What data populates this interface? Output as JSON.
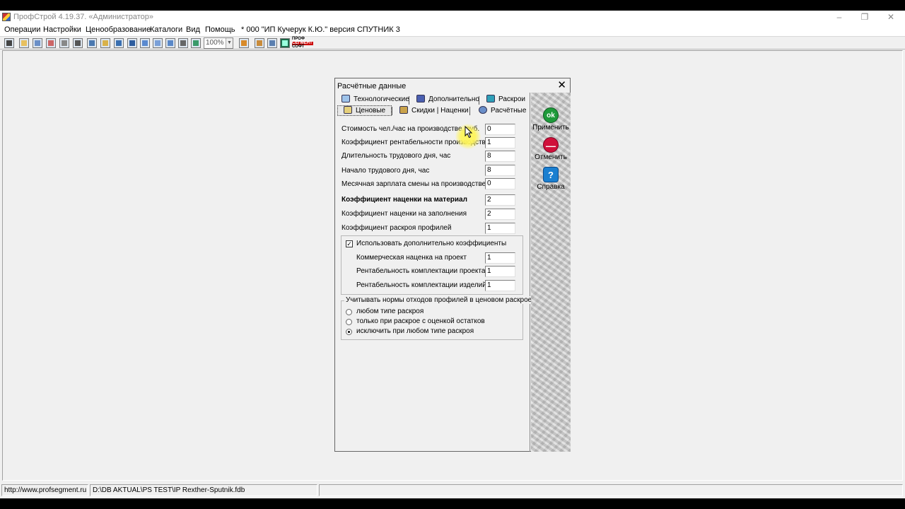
{
  "window": {
    "title": "ПрофСтрой 4.19.37. «Администратор»",
    "controls": [
      "–",
      "❐",
      "✕"
    ]
  },
  "menu": {
    "items": [
      "Операции",
      "Настройки",
      "Ценообразование",
      "Каталоги",
      "Вид",
      "Помощь",
      "* 000 \"ИП Кучерук К.Ю.\" версия СПУТНИК 3"
    ]
  },
  "toolbar": {
    "zoom": "100%",
    "logo_lines": [
      "ПРОФ",
      "СЕГМЕНТ",
      "СОФТ"
    ]
  },
  "status": {
    "url": "http://www.profsegment.ru",
    "db_path": "D:\\DB AKTUAL\\PS TEST\\IP Rexther-Sputnik.fdb"
  },
  "dialog": {
    "title": "Расчётные данные",
    "tabs_row1": [
      {
        "label": "Технологические",
        "icon": "list-icon"
      },
      {
        "label": "Дополнительно",
        "icon": "document-icon"
      },
      {
        "label": "Раскрои",
        "icon": "grid-icon"
      }
    ],
    "tabs_row2": [
      {
        "label": "Ценовые",
        "icon": "money-icon",
        "active": true
      },
      {
        "label": "Скидки | Наценки",
        "icon": "discount-icon"
      },
      {
        "label": "Расчётные",
        "icon": "calc-icon"
      }
    ],
    "fields": [
      {
        "label": "Стоимость чел./час на производстве, руб.",
        "value": "0",
        "bold": false
      },
      {
        "label": "Коэффициент рентабельности производства",
        "value": "1",
        "bold": false
      },
      {
        "label": "Длительность трудового дня, час",
        "value": "8",
        "bold": false
      },
      {
        "label": "Начало трудового дня, час",
        "value": "8",
        "bold": false
      },
      {
        "label": "Месячная зарплата смены на производстве, руб.",
        "value": "0",
        "bold": false
      },
      {
        "label": "Коэффициент наценки на материал",
        "value": "2",
        "bold": true
      },
      {
        "label": "Коэффициент наценки на заполнения",
        "value": "2",
        "bold": false
      },
      {
        "label": "Коэффициент раскроя профилей",
        "value": "1",
        "bold": false
      }
    ],
    "extra_group": {
      "checkbox_label": "Использовать дополнительно коэффициенты",
      "checked": true,
      "fields": [
        {
          "label": "Коммерческая наценка на проект",
          "value": "1"
        },
        {
          "label": "Рентабельность комплектации проекта",
          "value": "1"
        },
        {
          "label": "Рентабельность комплектации изделий",
          "value": "1"
        }
      ]
    },
    "waste_group": {
      "title": "Учитывать нормы отходов профилей в ценовом раскрое",
      "options": [
        {
          "label": "любом типе раскроя",
          "selected": false
        },
        {
          "label": "только при раскрое с оценкой остатков",
          "selected": false
        },
        {
          "label": "исключить при любом типе раскроя",
          "selected": true
        }
      ]
    },
    "side_buttons": [
      {
        "label": "Применить",
        "glyph": "ok",
        "color": "#1e9a3a",
        "icon": "ok-icon"
      },
      {
        "label": "Отменить",
        "glyph": "—",
        "color": "#d0103a",
        "icon": "cancel-icon"
      },
      {
        "label": "Справка",
        "glyph": "?",
        "color": "#1a7fd0",
        "icon": "help-icon"
      }
    ]
  }
}
